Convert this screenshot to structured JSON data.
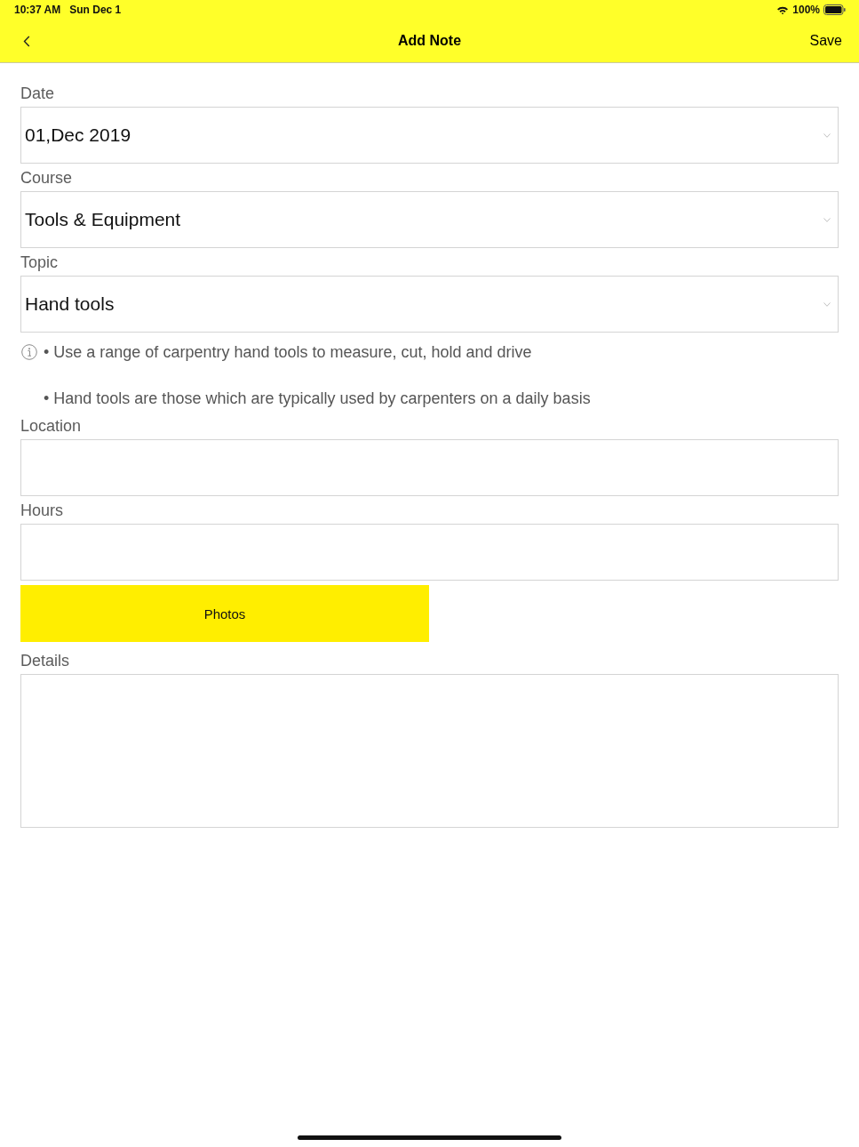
{
  "status_bar": {
    "time": "10:37 AM",
    "date": "Sun Dec 1",
    "battery": "100%"
  },
  "nav_bar": {
    "title": "Add Note",
    "action": "Save"
  },
  "form": [
    {
      "kind": "select",
      "label": "Date",
      "value": "01,Dec 2019"
    },
    {
      "kind": "select",
      "label": "Course",
      "value": "Tools & Equipment"
    },
    {
      "kind": "select",
      "label": "Topic",
      "value": "Hand tools"
    },
    {
      "kind": "info",
      "lines": [
        "• Use a range of carpentry hand tools to measure, cut, hold and drive",
        "• Hand tools are those which are typically used by carpenters on a daily basis"
      ]
    },
    {
      "kind": "text",
      "label": "Location"
    },
    {
      "kind": "text",
      "label": "Hours"
    },
    {
      "kind": "button",
      "label": "Photos"
    },
    {
      "kind": "textarea",
      "label": "Details"
    }
  ]
}
